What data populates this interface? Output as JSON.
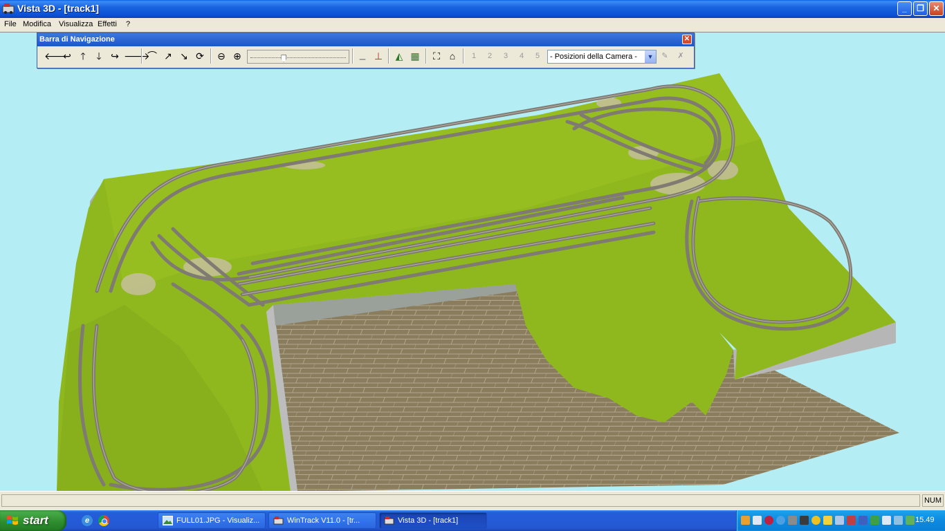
{
  "window": {
    "title": "Vista 3D - [track1]",
    "controls": {
      "minimize": "_",
      "maximize": "❐",
      "close": "✕"
    }
  },
  "menu": {
    "items": [
      "File",
      "Modifica",
      "Visualizza",
      "Effetti",
      "?"
    ]
  },
  "navigation_toolbar": {
    "title": "Barra di Navigazione",
    "close": "✕",
    "camera_select": {
      "value": "- Posizioni della Camera -"
    },
    "camera_slots": [
      "1",
      "2",
      "3",
      "4",
      "5"
    ],
    "zoom_level_fraction": 0.35
  },
  "statusbar": {
    "indicator": "NUM"
  },
  "taskbar": {
    "start_label": "start",
    "tasks": [
      {
        "label": "FULL01.JPG - Visualiz...",
        "active": false
      },
      {
        "label": "WinTrack  V11.0 - [tr...",
        "active": false
      },
      {
        "label": "Vista 3D - [track1]",
        "active": true
      }
    ],
    "clock": "15.49"
  },
  "colors": {
    "sky": "#b4eef4",
    "terrain": "#8fb81e",
    "track": "#7f7a72",
    "floor": "#8a7d5e",
    "titlebar": "#0b4fd4"
  }
}
